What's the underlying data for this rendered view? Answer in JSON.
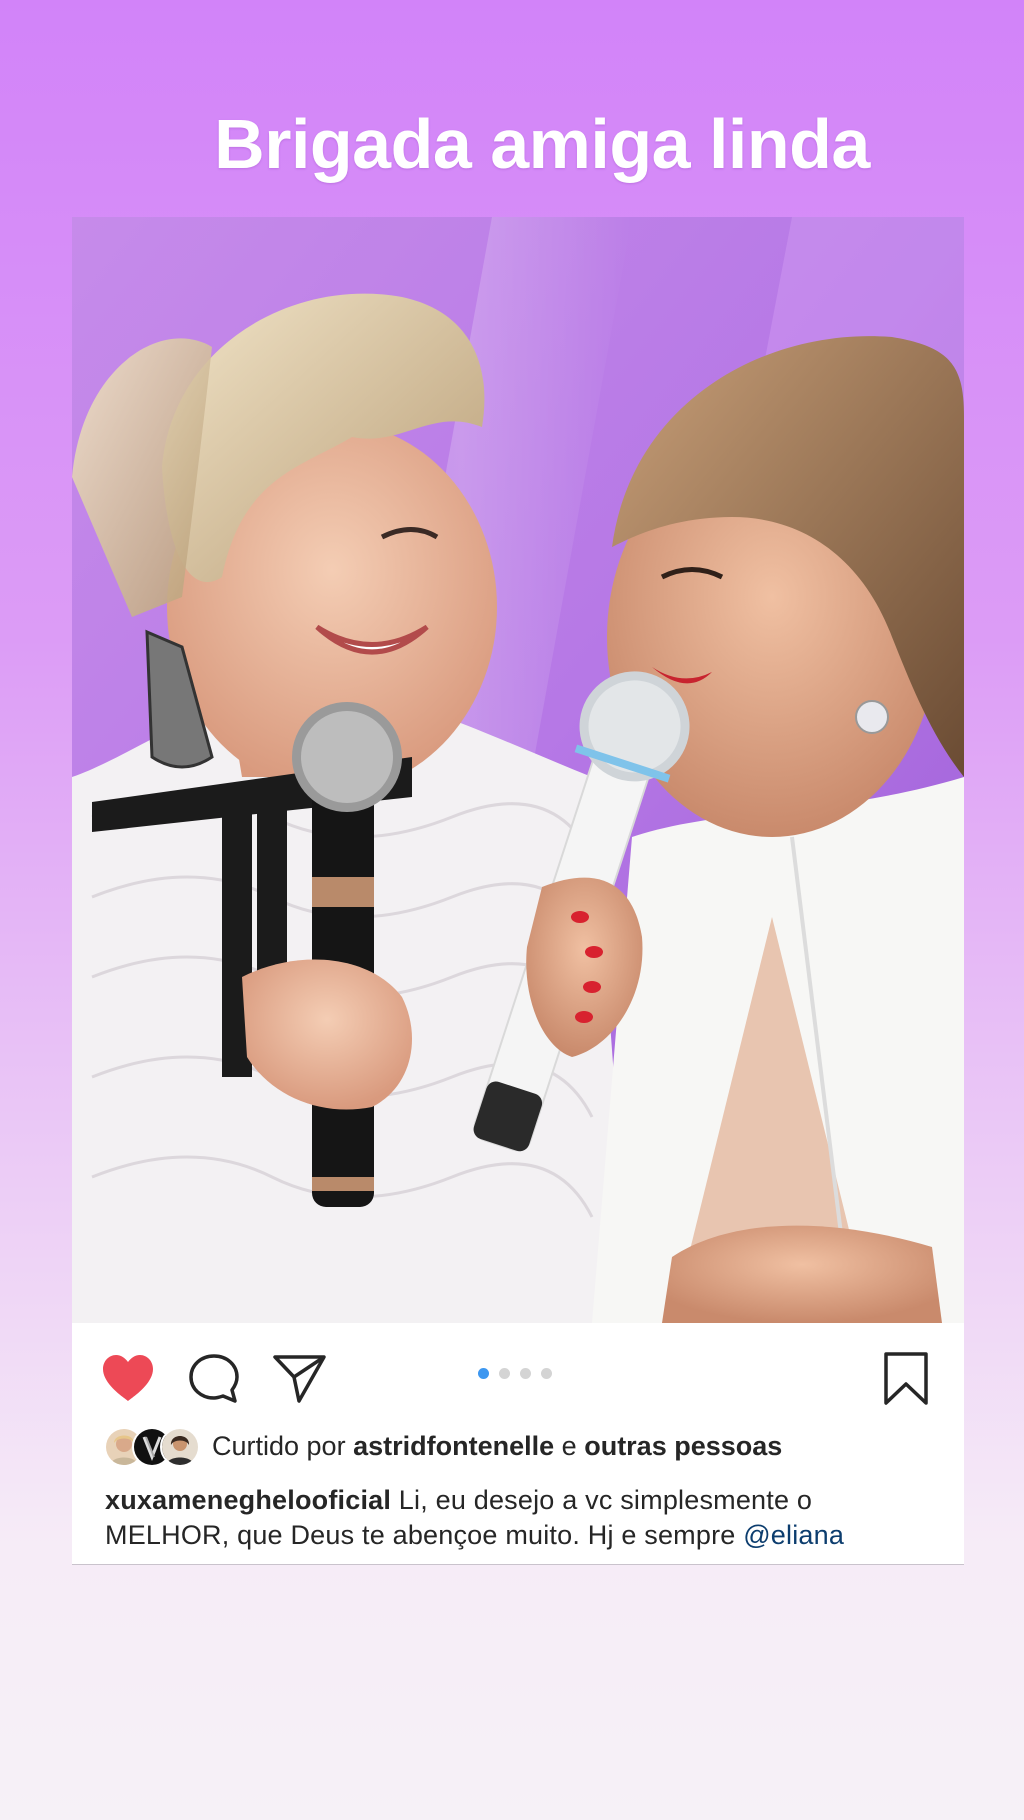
{
  "story": {
    "caption": "Brigada amiga linda"
  },
  "post": {
    "actions": {
      "like_icon": "heart-filled-icon",
      "comment_icon": "speech-bubble-icon",
      "share_icon": "paper-plane-icon",
      "save_icon": "bookmark-icon"
    },
    "carousel": {
      "total": 4,
      "active_index": 1
    },
    "likes": {
      "prefix": "Curtido por",
      "user": "astridfontenelle",
      "connector": "e",
      "others": "outras pessoas"
    },
    "caption": {
      "username": "xuxameneghelooficial",
      "text_line1": " Li, eu desejo a vc simplesmente o",
      "text_line2": "MELHOR, que Deus te abençoe muito. Hj e sempre ",
      "mention": "@eliana"
    }
  },
  "colors": {
    "background_top": "#d283f9",
    "background_bottom": "#f6f1f7",
    "like_red": "#ed4956",
    "active_dot": "#3d97f0",
    "inactive_dot": "#d4d4d4",
    "mention_blue": "#0c3d6e",
    "text": "#262626"
  }
}
